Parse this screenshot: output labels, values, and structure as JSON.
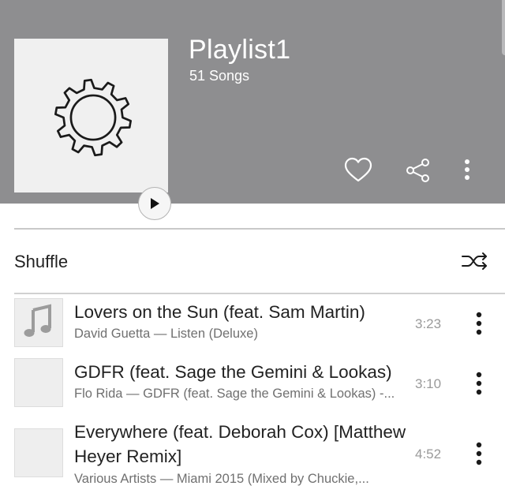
{
  "playlist": {
    "title": "Playlist1",
    "song_count": "51 Songs"
  },
  "header_actions": {
    "favorite_icon": "heart-outline-icon",
    "share_icon": "share-icon",
    "more_icon": "more-vertical-icon"
  },
  "shuffle": {
    "label": "Shuffle",
    "icon": "shuffle-icon"
  },
  "songs": [
    {
      "title": "Lovers on the Sun (feat. Sam Martin)",
      "subtitle": "David Guetta — Listen (Deluxe)",
      "duration": "3:23",
      "thumb_icon": "music-note-icon"
    },
    {
      "title": "GDFR (feat. Sage the Gemini & Lookas)",
      "subtitle": "Flo Rida — GDFR (feat. Sage the Gemini & Lookas) -...",
      "duration": "3:10"
    },
    {
      "title": "Everywhere (feat. Deborah Cox) [Matthew Heyer Remix]",
      "subtitle": "Various Artists — Miami 2015 (Mixed by Chuckie,...",
      "duration": "4:52"
    }
  ],
  "colors": {
    "header_bg": "#8e8e90",
    "header_text": "#ffffff",
    "divider": "#c9c9c9"
  }
}
